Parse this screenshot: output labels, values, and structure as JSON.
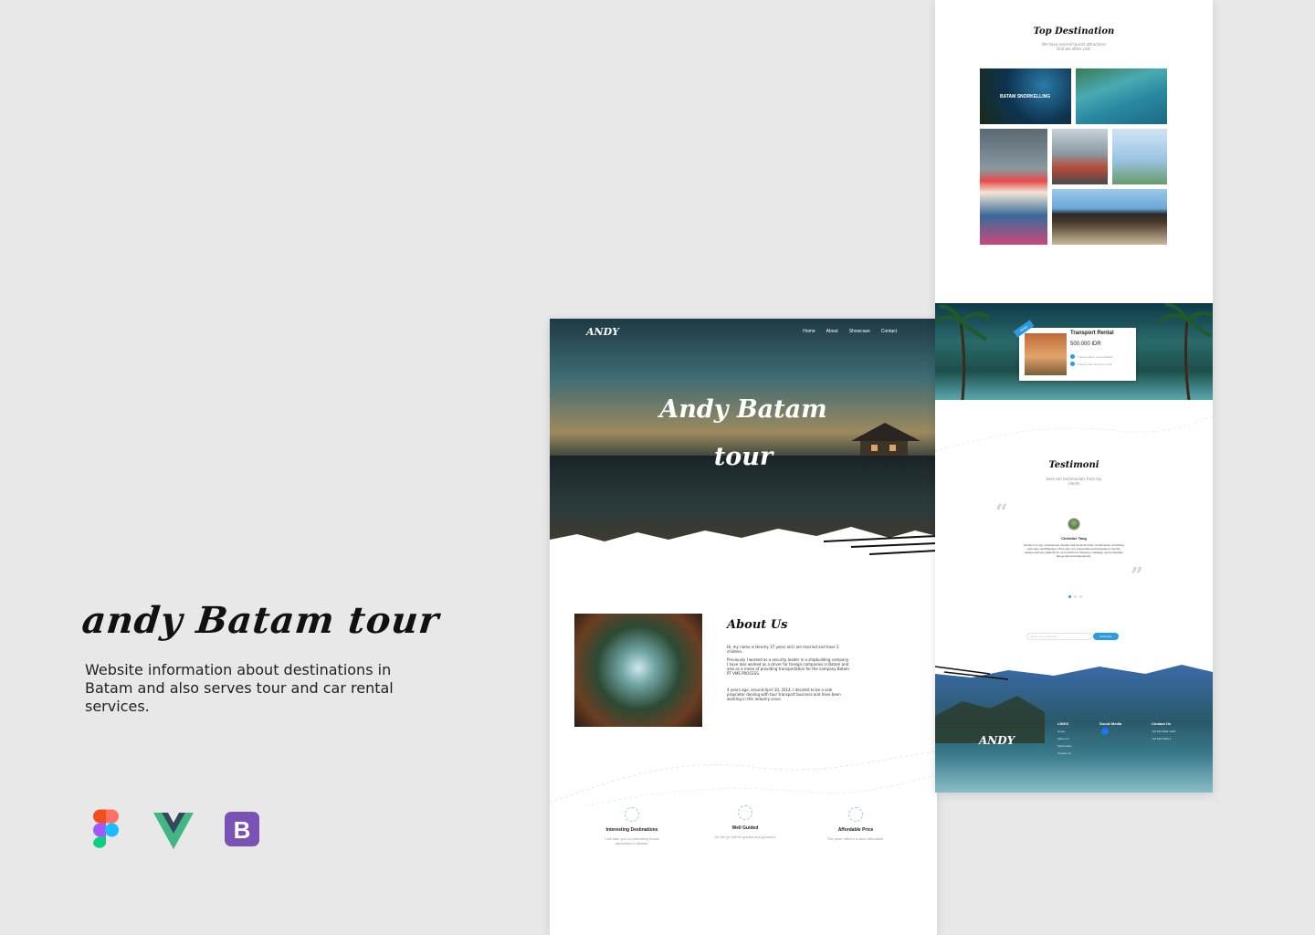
{
  "intro": {
    "title": "andy Batam tour",
    "description": "Website information about destinations in Batam and also serves tour and car rental services."
  },
  "tools": [
    {
      "icon": "figma-icon",
      "colors": [
        "#f24e1e",
        "#ff7262",
        "#a259ff",
        "#1abcfe",
        "#0acf83"
      ]
    },
    {
      "icon": "vue-icon",
      "colors": [
        "#41b883",
        "#35495e"
      ]
    },
    {
      "icon": "bootstrap-icon",
      "letter": "B",
      "colors": [
        "#7952b3"
      ]
    }
  ],
  "home": {
    "logo": "ANDY",
    "nav": [
      "Home",
      "About",
      "Showcase",
      "Contact"
    ],
    "hero_title_line1": "Andy Batam",
    "hero_title_line2": "tour",
    "about": {
      "heading": "About Us",
      "paragraphs": [
        "Hi, my name is Hendry 37 years old I am married and have 3 children.",
        "Previously I worked as a security leader in a shipbuilding company. I have also worked as a driver for foreign companies in Batam and also as a mean of providing transportation for the company Batam PT VME PROCESS.",
        "4 years ago, around April 10, 2014, I decided to be a sole proprietor dealing with tour transport business and have been working in this industry since."
      ]
    },
    "features": [
      {
        "title": "Interesting Destinations",
        "desc": "I will take you to interesting tourist attractions in Batam.",
        "icon": "destination-icon"
      },
      {
        "title": "Well Guided",
        "desc": "On the go will be guided and guarded.",
        "icon": "guide-icon"
      },
      {
        "title": "Affordable Price",
        "desc": "The price offered is also affordable.",
        "icon": "price-icon"
      }
    ]
  },
  "destination": {
    "title": "Top Destination",
    "subtitle_line1": "We have several tourist attractions",
    "subtitle_line2": "that we often visit.",
    "first_label": "BATAM SNORKELLING"
  },
  "rental": {
    "ribbon": "Rental",
    "title": "Transport Rental",
    "price": "500.000 IDR",
    "features": [
      "Transportation around Batam",
      "Starting from airport to hotel"
    ]
  },
  "testimoni": {
    "title": "Testimoni",
    "subtitle_line1": "Here are testimonials from my",
    "subtitle_line2": "clients",
    "name": "Christine Tang",
    "body": "Hendry is a very experienced, friendly and punctual driver. Confirmation of booking was easy via WhatsApp. Price was very reasonable and transparent. Hendry always well very patiently for us to finish our shopping, massage, sports activities like go-kart and watersports."
  },
  "subscribe": {
    "placeholder": "Enter your email here",
    "button": "Subscribe"
  },
  "footer": {
    "logo": "ANDY",
    "links_heading": "LINKS",
    "links": [
      "Home",
      "About Us",
      "Show Case",
      "Contact Us"
    ],
    "social_heading": "Social Media",
    "contact_heading": "Contact Us",
    "contacts": [
      "+62 812-6401-2423",
      "+62 813-7064-1"
    ]
  }
}
